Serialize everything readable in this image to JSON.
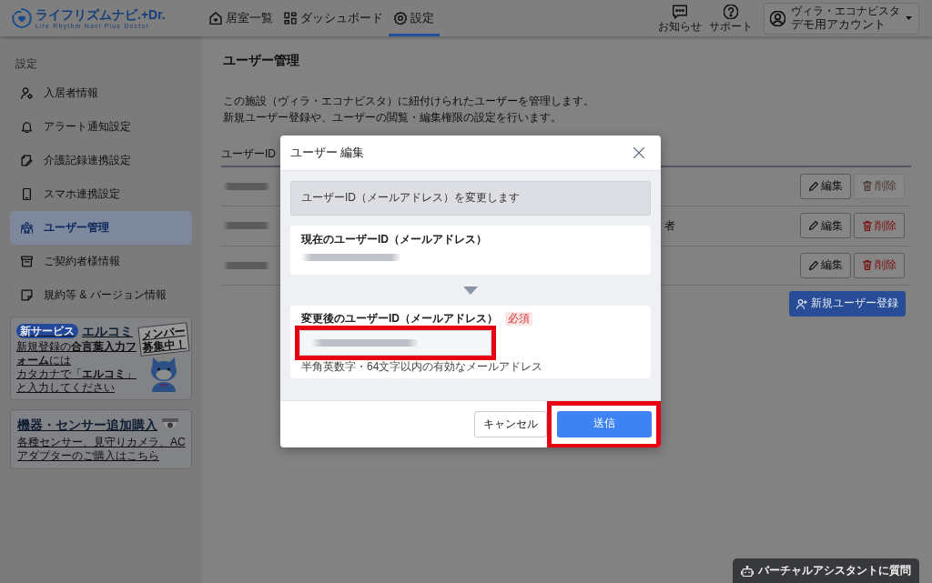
{
  "header": {
    "logo": {
      "name": "ライフリズムナビ.+Dr.",
      "tagline": "Life Rhythm Navi Plus Doctor"
    },
    "tabs": [
      {
        "label": "居室一覧",
        "selected": false
      },
      {
        "label": "ダッシュボード",
        "selected": false
      },
      {
        "label": "設定",
        "selected": true
      }
    ],
    "tools": [
      {
        "label": "お知らせ"
      },
      {
        "label": "サポート"
      }
    ],
    "account": {
      "facility": "ヴィラ・エコナビスタ",
      "name": "デモ用アカウント"
    }
  },
  "sidebar": {
    "section": "設定",
    "items": [
      {
        "label": "入居者情報",
        "selected": false
      },
      {
        "label": "アラート通知設定",
        "selected": false
      },
      {
        "label": "介護記録連携設定",
        "selected": false
      },
      {
        "label": "スマホ連携設定",
        "selected": false
      },
      {
        "label": "ユーザー管理",
        "selected": true
      },
      {
        "label": "ご契約者様情報",
        "selected": false
      },
      {
        "label": "規約等 & バージョン情報",
        "selected": false
      }
    ],
    "banners": [
      {
        "kind": "service",
        "badge": "新サービス",
        "title": "エルコミ",
        "sign": [
          "メンバー",
          "募集中！"
        ],
        "lines": [
          "新規登録の**合言葉入力フォーム**には",
          "カタカナで「**エルコミ**」と入力してください"
        ]
      },
      {
        "kind": "purchase",
        "title": "機器・センサー追加購入",
        "lines": [
          "各種センサー、見守りカメラ、ACアダプターのご購入はこちら"
        ]
      }
    ]
  },
  "main": {
    "title": "ユーザー管理",
    "description": [
      "この施設（ヴィラ・エコナビスタ）に紐付けられたユーザーを管理します。",
      "新規ユーザー登録や、ユーザーの閲覧・編集権限の設定を行います。"
    ],
    "table": {
      "columns": [
        "ユーザーID"
      ],
      "rows": [
        {
          "user_id_redacted": true,
          "edit": "編集",
          "delete": {
            "label": "削除",
            "disabled": true
          }
        },
        {
          "user_id_redacted": true,
          "column_3": "者",
          "edit": "編集",
          "delete": {
            "label": "削除",
            "disabled": false
          }
        },
        {
          "user_id_redacted": true,
          "edit": "編集",
          "delete": {
            "label": "削除",
            "disabled": false
          }
        }
      ]
    },
    "add_button": "新規ユーザー登録"
  },
  "modal": {
    "title": "ユーザー 編集",
    "notice": "ユーザーID（メールアドレス）を変更します",
    "current_id": {
      "label": "現在のユーザーID（メールアドレス）",
      "value_redacted": true
    },
    "new_id": {
      "label": "変更後のユーザーID（メールアドレス）",
      "required": "必須",
      "value_redacted": true,
      "highlighted": true,
      "hint": "半角英数字・64文字以内の有効なメールアドレス"
    },
    "buttons": [
      {
        "label": "キャンセル",
        "kind": "secondary",
        "highlighted": false
      },
      {
        "label": "送信",
        "kind": "primary",
        "highlighted": true
      }
    ]
  },
  "assistant": {
    "label": "バーチャルアシスタントに質問"
  }
}
